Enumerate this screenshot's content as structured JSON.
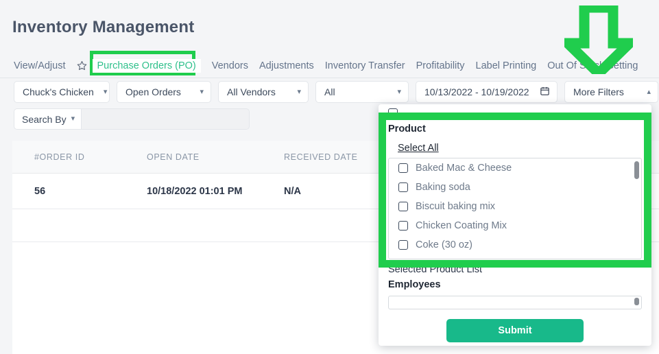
{
  "header": {
    "title": "Inventory Management"
  },
  "tabs": [
    {
      "label": "View/Adjust",
      "active": false
    },
    {
      "label": "Purchase Orders (PO)",
      "active": true
    },
    {
      "label": "Vendors",
      "active": false
    },
    {
      "label": "Adjustments",
      "active": false
    },
    {
      "label": "Inventory Transfer",
      "active": false
    },
    {
      "label": "Profitability",
      "active": false
    },
    {
      "label": "Label Printing",
      "active": false
    },
    {
      "label": "Out Of Stock Setting",
      "active": false
    }
  ],
  "filters": {
    "store": "Chuck's Chicken",
    "status": "Open Orders",
    "vendor": "All Vendors",
    "all": "All",
    "date_range": "10/13/2022 - 10/19/2022",
    "more_filters": "More Filters",
    "search_by": "Search By",
    "search_value": "",
    "search_placeholder": ""
  },
  "table": {
    "columns": [
      "#ORDER ID",
      "OPEN DATE",
      "RECEIVED DATE"
    ],
    "rows": [
      {
        "order_id": "56",
        "open_date": "10/18/2022 01:01 PM",
        "received_date": "N/A"
      }
    ]
  },
  "more_filters_panel": {
    "product_label": "Product",
    "select_all": "Select All",
    "products": [
      {
        "name": "Baked Mac & Cheese",
        "checked": false
      },
      {
        "name": "Baking soda",
        "checked": false
      },
      {
        "name": "Biscuit baking mix",
        "checked": false
      },
      {
        "name": "Chicken Coating Mix",
        "checked": false
      },
      {
        "name": "Coke (30 oz)",
        "checked": false
      }
    ],
    "selected_product_list_label": "Selected Product List",
    "employees_label": "Employees",
    "employees_value": "",
    "submit_label": "Submit"
  },
  "annotations": {
    "highlight_color": "#20cd4d",
    "arrow_color": "#20cd4d",
    "accent_color": "#18b98a",
    "active_tab_color": "#2fc08b"
  },
  "icons": {
    "star": "star-icon",
    "calendar": "calendar-icon",
    "chevron_down": "chevron-down-icon",
    "chevron_up": "chevron-up-icon"
  }
}
